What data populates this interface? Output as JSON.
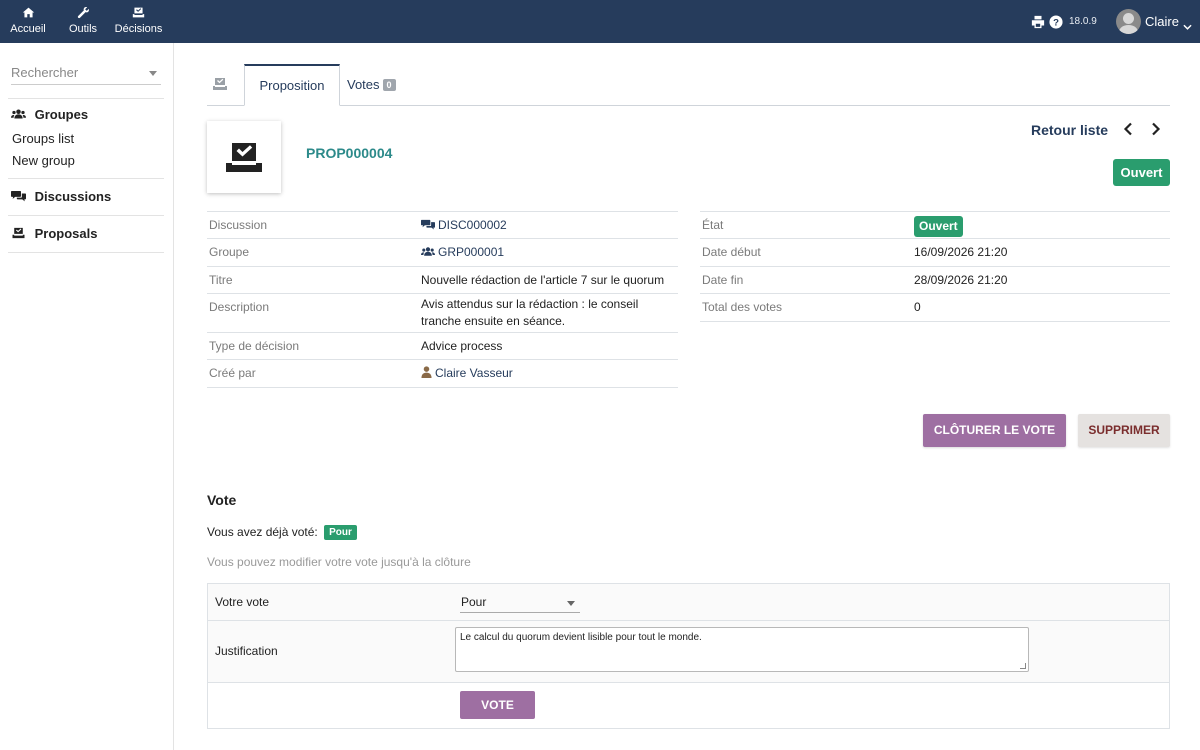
{
  "topbar": {
    "nav": [
      {
        "label": "Accueil",
        "icon": "home-icon"
      },
      {
        "label": "Outils",
        "icon": "wrench-icon"
      },
      {
        "label": "Décisions",
        "icon": "vote-box-icon"
      }
    ],
    "version": "18.0.9",
    "user_name": "Claire"
  },
  "sidebar": {
    "search_placeholder": "Rechercher",
    "groups_title": "Groupes",
    "groups_links": [
      "Groups list",
      "New group"
    ],
    "discussions_title": "Discussions",
    "proposals_title": "Proposals"
  },
  "tabs": {
    "proposition": "Proposition",
    "votes": "Votes",
    "votes_count": "0"
  },
  "record": {
    "ref": "PROP000004",
    "back_list": "Retour liste",
    "status": "Ouvert"
  },
  "fields_left": {
    "discussion_label": "Discussion",
    "discussion_value": "DISC000002",
    "groupe_label": "Groupe",
    "groupe_value": "GRP000001",
    "titre_label": "Titre",
    "titre_value": "Nouvelle rédaction de l'article 7 sur le quorum",
    "description_label": "Description",
    "description_line1": "Avis attendus sur la rédaction : le conseil",
    "description_line2": "tranche ensuite en séance.",
    "type_label": "Type de décision",
    "type_value": "Advice process",
    "cree_label": "Créé par",
    "cree_value": "Claire Vasseur"
  },
  "fields_right": {
    "etat_label": "État",
    "etat_value": "Ouvert",
    "debut_label": "Date début",
    "debut_value": "16/09/2026 21:20",
    "fin_label": "Date fin",
    "fin_value": "28/09/2026 21:20",
    "total_label": "Total des votes",
    "total_value": "0"
  },
  "actions": {
    "close_vote": "CLÔTURER LE VOTE",
    "delete": "SUPPRIMER"
  },
  "vote": {
    "title": "Vote",
    "already_voted": "Vous avez déjà voté:",
    "already_value": "Pour",
    "hint": "Vous pouvez modifier votre vote jusqu'à la clôture",
    "your_vote_label": "Votre vote",
    "your_vote_value": "Pour",
    "justification_label": "Justification",
    "justification_value": "Le calcul du quorum devient lisible pour tout le monde.",
    "submit": "VOTE"
  },
  "colors": {
    "topbar": "#263c5c",
    "accent_purple": "#9e6fa2",
    "status_green": "#2a9d6e",
    "ref_teal": "#2c8a8a"
  }
}
